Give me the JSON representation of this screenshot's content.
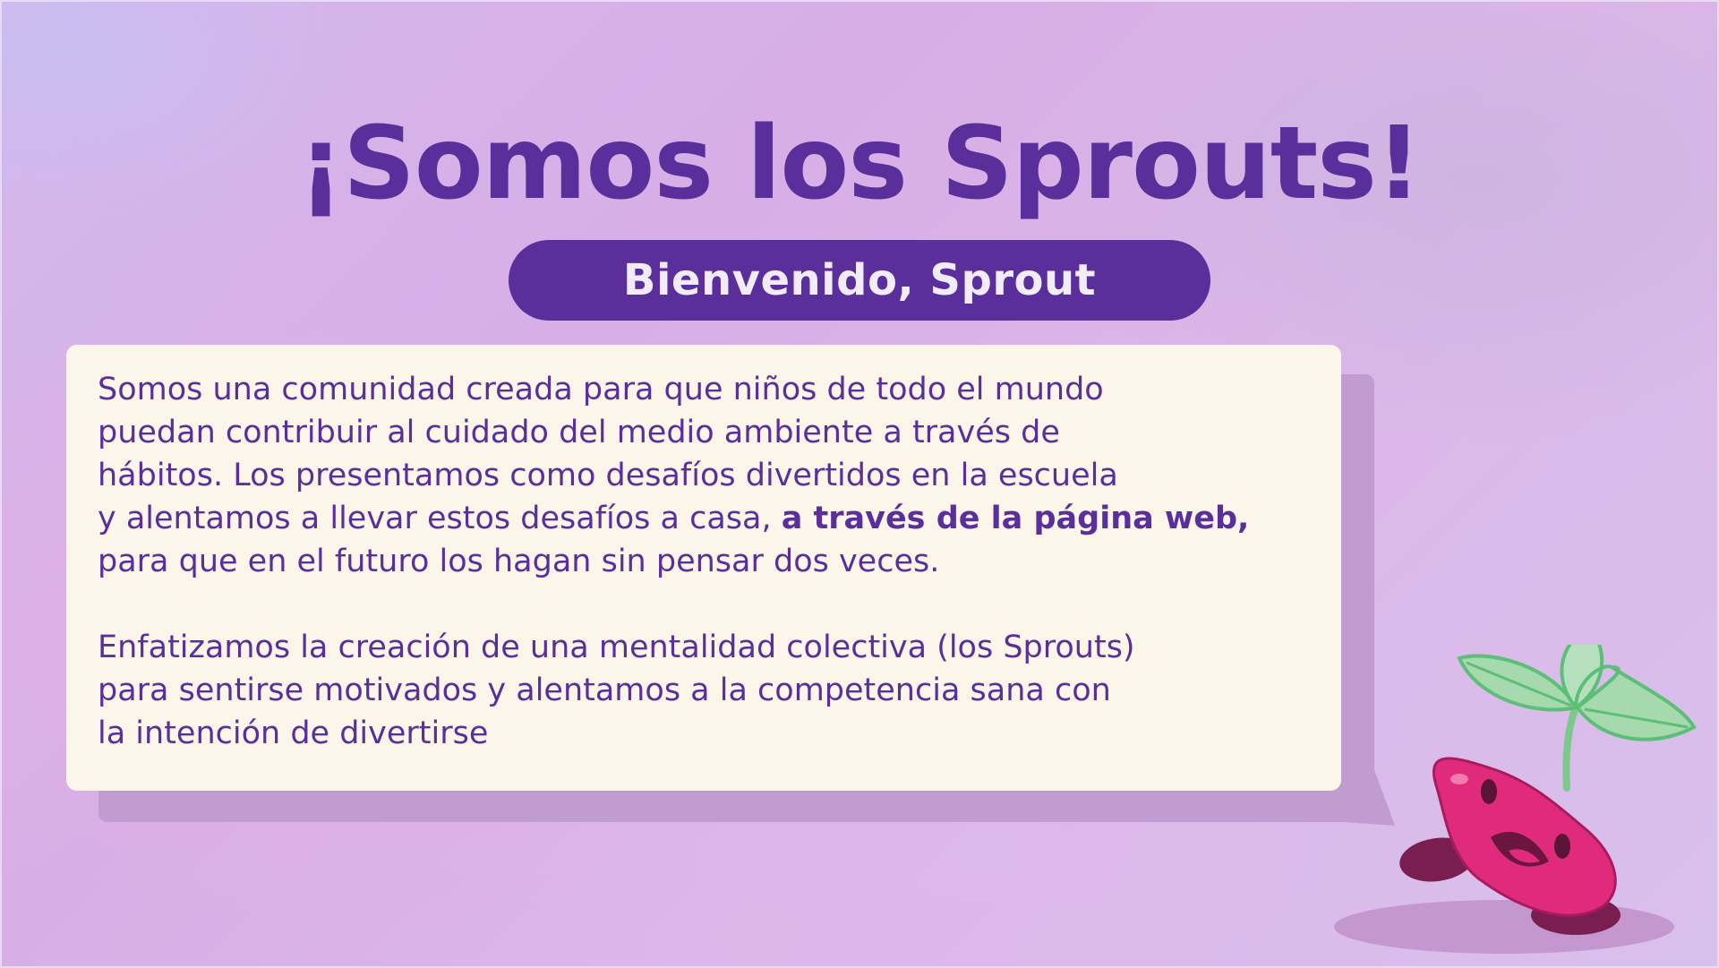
{
  "title": "¡Somos los Sprouts!",
  "subtitle": "Bienvenido, Sprout",
  "intro": {
    "line1": "Somos una comunidad creada para que niños de todo el mundo",
    "line2": "puedan contribuir al cuidado del medio ambiente a través de",
    "line3": "hábitos. Los presentamos como desafíos divertidos en la escuela",
    "line4_start": "y alentamos a llevar estos desafíos a casa, ",
    "line4_bold": "a través de la página web,",
    "line5": "para que en el futuro los hagan sin pensar dos veces."
  },
  "second": {
    "line1": "Enfatizamos la creación de una mentalidad colectiva (los Sprouts)",
    "line2": "para sentirse motivados y alentamos a la competencia sana con",
    "line3": "la intención de divertirse"
  },
  "colors": {
    "accent": "#5a2f9c",
    "card": "#fcf5e9",
    "card_shadow": "#c19cd0",
    "mascot_body": "#e02a7c",
    "leaf": "#9fd6a8"
  },
  "icons": {
    "mascot": "sprout-bean-mascot"
  }
}
